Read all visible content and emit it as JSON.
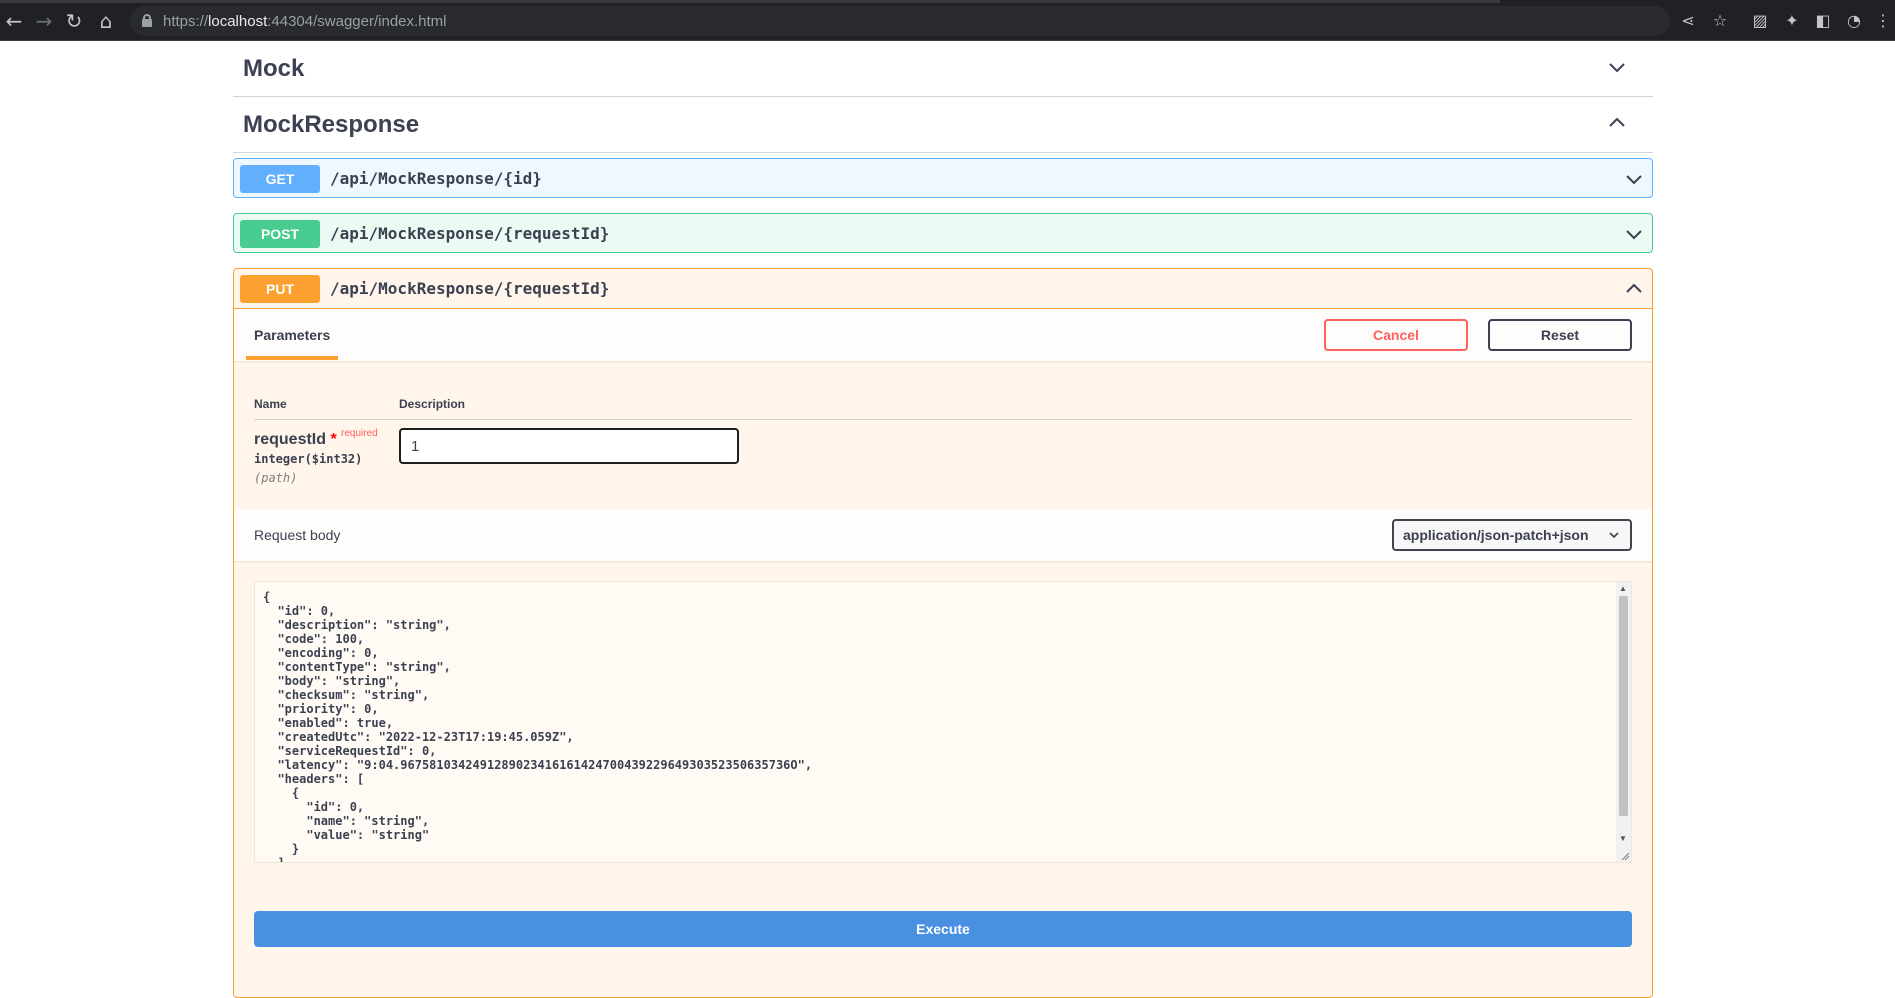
{
  "browser": {
    "url_scheme": "https://",
    "url_host": "localhost",
    "url_rest": ":44304/swagger/index.html"
  },
  "sections": [
    {
      "title": "Mock",
      "expanded": false
    },
    {
      "title": "MockResponse",
      "expanded": true
    }
  ],
  "operations": {
    "get": {
      "method": "GET",
      "path": "/api/MockResponse/{id}"
    },
    "post": {
      "method": "POST",
      "path": "/api/MockResponse/{requestId}"
    },
    "put": {
      "method": "PUT",
      "path": "/api/MockResponse/{requestId}"
    }
  },
  "put_panel": {
    "tab_label": "Parameters",
    "cancel_label": "Cancel",
    "reset_label": "Reset",
    "col_name": "Name",
    "col_description": "Description",
    "param": {
      "name": "requestId",
      "star": "*",
      "required_label": "required",
      "type": "integer($int32)",
      "in": "(path)",
      "value": "1"
    },
    "request_body_label": "Request body",
    "content_type": "application/json-patch+json",
    "body_json": "{\n  \"id\": 0,\n  \"description\": \"string\",\n  \"code\": 100,\n  \"encoding\": 0,\n  \"contentType\": \"string\",\n  \"body\": \"string\",\n  \"checksum\": \"string\",\n  \"priority\": 0,\n  \"enabled\": true,\n  \"createdUtc\": \"2022-12-23T17:19:45.059Z\",\n  \"serviceRequestId\": 0,\n  \"latency\": \"9:04.967581034249128902341616142470043922964930352350635736O\",\n  \"headers\": [\n    {\n      \"id\": 0,\n      \"name\": \"string\",\n      \"value\": \"string\"\n    }\n  ]",
    "execute_label": "Execute"
  },
  "colors": {
    "get": "#61affe",
    "post": "#49cc90",
    "put": "#fca130",
    "execute": "#4990e2",
    "cancel": "#ff6060"
  }
}
